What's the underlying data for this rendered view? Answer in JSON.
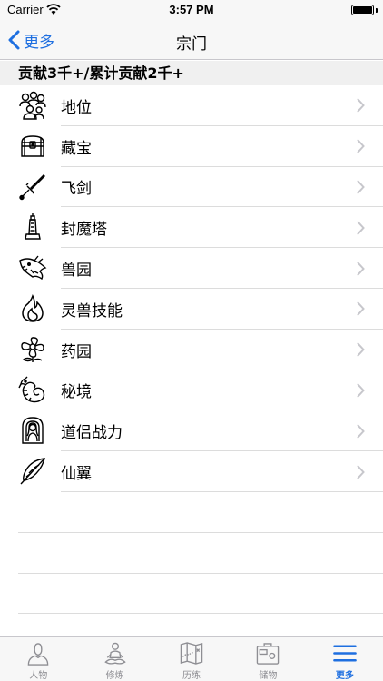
{
  "status": {
    "carrier": "Carrier",
    "time": "3:57 PM"
  },
  "nav": {
    "back_label": "更多",
    "title": "宗门"
  },
  "section": {
    "header": "贡献3千+/累计贡献2千+"
  },
  "items": [
    {
      "label": "地位",
      "icon": "people-icon"
    },
    {
      "label": "藏宝",
      "icon": "treasure-chest-icon"
    },
    {
      "label": "飞剑",
      "icon": "sword-icon"
    },
    {
      "label": "封魔塔",
      "icon": "tower-icon"
    },
    {
      "label": "兽园",
      "icon": "dragon-head-icon"
    },
    {
      "label": "灵兽技能",
      "icon": "flame-icon"
    },
    {
      "label": "药园",
      "icon": "flower-icon"
    },
    {
      "label": "秘境",
      "icon": "dragon-icon"
    },
    {
      "label": "道侣战力",
      "icon": "portrait-icon"
    },
    {
      "label": "仙翼",
      "icon": "feather-icon"
    }
  ],
  "tabs": [
    {
      "label": "人物",
      "icon": "person-icon"
    },
    {
      "label": "修炼",
      "icon": "meditation-icon"
    },
    {
      "label": "历练",
      "icon": "map-icon"
    },
    {
      "label": "储物",
      "icon": "inventory-icon"
    },
    {
      "label": "更多",
      "icon": "menu-icon",
      "active": true
    }
  ],
  "colors": {
    "accent": "#1e6fe0",
    "tab_inactive": "#8e8e93"
  }
}
